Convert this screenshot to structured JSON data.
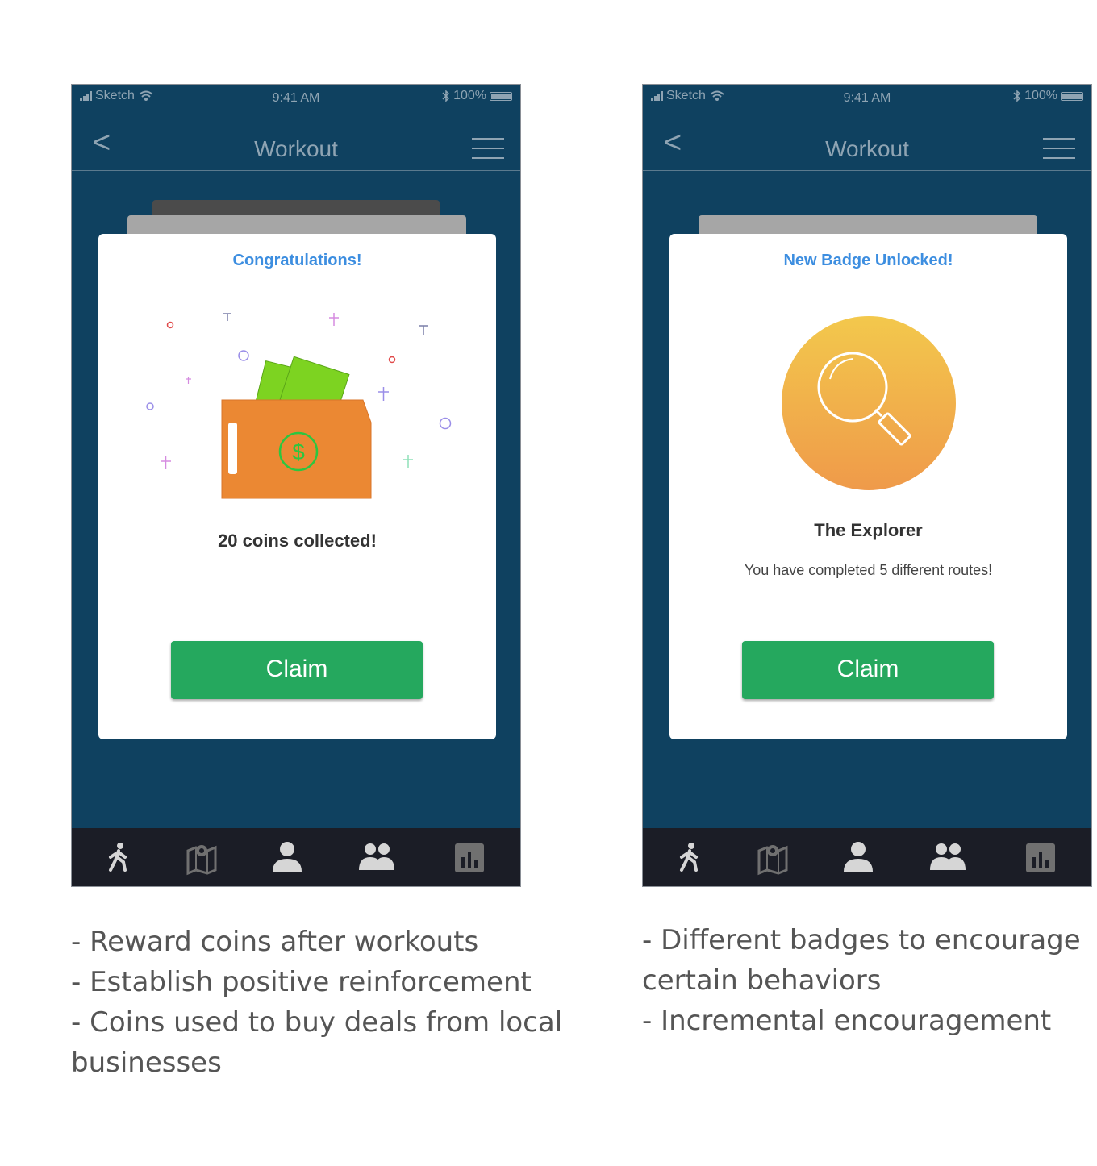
{
  "status_bar": {
    "carrier": "Sketch",
    "time": "9:41 AM",
    "battery": "100%"
  },
  "left_screen": {
    "nav_title": "Workout",
    "back_label": "<",
    "card": {
      "heading": "Congratulations!",
      "dollar_sign": "$",
      "message": "20 coins collected!",
      "claim_label": "Claim"
    }
  },
  "right_screen": {
    "nav_title": "Workout",
    "back_label": "<",
    "card": {
      "heading": "New Badge Unlocked!",
      "badge_title": "The Explorer",
      "badge_description": "You have completed 5 different routes!",
      "claim_label": "Claim"
    }
  },
  "tab_icons": [
    "walk-icon",
    "map-icon",
    "profile-icon",
    "friends-icon",
    "stats-icon"
  ],
  "captions": {
    "left": [
      "- Reward coins after workouts",
      "- Establish positive reinforcement",
      "- Coins used to buy deals from local",
      "businesses"
    ],
    "right": [
      "- Different badges to encourage",
      "certain behaviors",
      "- Incremental encouragement"
    ]
  },
  "colors": {
    "background": "#0f4160",
    "accent_blue": "#3d8ee0",
    "claim_green": "#25a85e",
    "wallet_orange": "#eb8833",
    "cash_green": "#7dd321",
    "badge_gold": "#f2c14e",
    "tab_bar": "#1b1d26"
  }
}
